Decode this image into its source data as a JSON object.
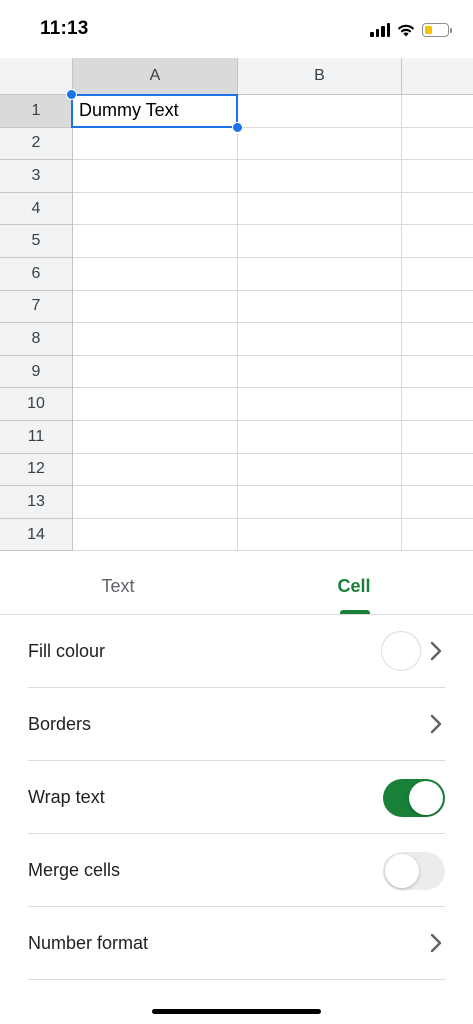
{
  "status_bar": {
    "time": "11:13",
    "battery_color": "#f5c400"
  },
  "sheet": {
    "columns": [
      "A",
      "B"
    ],
    "rows": [
      "1",
      "2",
      "3",
      "4",
      "5",
      "6",
      "7",
      "8",
      "9",
      "10",
      "11",
      "12",
      "13",
      "14"
    ],
    "cells": {
      "A1": "Dummy Text"
    },
    "selected_cell": "A1",
    "selection_color": "#1a73e8"
  },
  "tabs": {
    "text_label": "Text",
    "cell_label": "Cell",
    "active": "Cell",
    "accent_color": "#188038"
  },
  "options": {
    "fill_colour": {
      "label": "Fill colour",
      "icon": "chevron-right-icon"
    },
    "borders": {
      "label": "Borders",
      "icon": "chevron-right-icon"
    },
    "wrap_text": {
      "label": "Wrap text",
      "enabled": true
    },
    "merge_cells": {
      "label": "Merge cells",
      "enabled": false
    },
    "number_format": {
      "label": "Number format",
      "icon": "chevron-right-icon"
    }
  }
}
